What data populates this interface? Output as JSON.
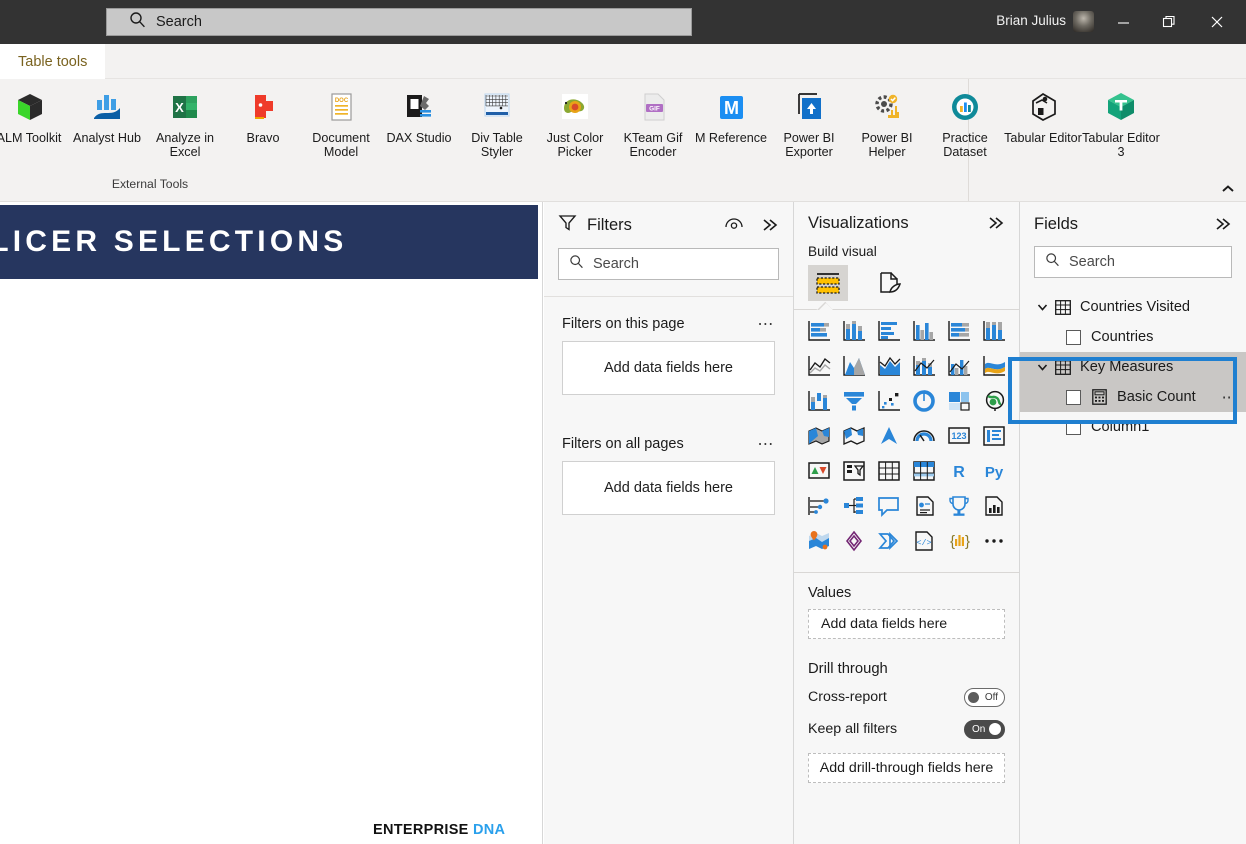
{
  "titlebar": {
    "search_placeholder": "Search",
    "search_icon": "search-icon",
    "user_name": "Brian Julius",
    "minimize_label": "─",
    "maximize_label": "❐",
    "close_label": "✕"
  },
  "ribbon": {
    "context_tab": "Table tools",
    "group_label": "External Tools",
    "collapse_label": "⌃",
    "tools": [
      {
        "name": "ALM Toolkit",
        "icon": "alm-toolkit-icon"
      },
      {
        "name": "Analyst Hub",
        "icon": "analyst-hub-icon"
      },
      {
        "name": "Analyze in Excel",
        "icon": "excel-icon"
      },
      {
        "name": "Bravo",
        "icon": "bravo-icon"
      },
      {
        "name": "Document Model",
        "icon": "document-model-icon"
      },
      {
        "name": "DAX Studio",
        "icon": "dax-studio-icon"
      },
      {
        "name": "Div Table Styler",
        "icon": "div-table-styler-icon"
      },
      {
        "name": "Just Color Picker",
        "icon": "just-color-picker-icon"
      },
      {
        "name": "KTeam Gif Encoder",
        "icon": "kteam-gif-encoder-icon"
      },
      {
        "name": "M Reference",
        "icon": "m-reference-icon"
      },
      {
        "name": "Power BI Exporter",
        "icon": "power-bi-exporter-icon"
      },
      {
        "name": "Power BI Helper",
        "icon": "power-bi-helper-icon"
      },
      {
        "name": "Practice Dataset",
        "icon": "practice-dataset-icon"
      },
      {
        "name": "Tabular Editor",
        "icon": "tabular-editor-icon"
      },
      {
        "name": "Tabular Editor 3",
        "icon": "tabular-editor-3-icon"
      }
    ]
  },
  "canvas": {
    "banner_text": "SLICER SELECTIONS",
    "banner_color": "#26365f",
    "footer_brand_primary": "ENTERPRISE",
    "footer_brand_secondary": "DNA"
  },
  "filters": {
    "title": "Filters",
    "eye_icon": "eye-icon",
    "collapse_icon": "chevron-double-right-icon",
    "funnel_icon": "funnel-icon",
    "search_placeholder": "Search",
    "sections": [
      {
        "label": "Filters on this page",
        "dropzone": "Add data fields here",
        "more": "⋯"
      },
      {
        "label": "Filters on all pages",
        "dropzone": "Add data fields here",
        "more": "⋯"
      }
    ]
  },
  "visualizations": {
    "title": "Visualizations",
    "collapse_icon": "chevron-double-right-icon",
    "build_visual_label": "Build visual",
    "build_tabs": [
      {
        "icon": "fields-build-icon",
        "selected": true
      },
      {
        "icon": "format-paintbrush-icon",
        "selected": false
      }
    ],
    "viz_icons": [
      "stacked-bar-chart-icon",
      "stacked-column-chart-icon",
      "clustered-bar-chart-icon",
      "clustered-column-chart-icon",
      "hundred-percent-stacked-bar-icon",
      "hundred-percent-stacked-column-icon",
      "line-chart-icon",
      "area-chart-icon",
      "stacked-area-chart-icon",
      "line-stacked-column-icon",
      "line-clustered-column-icon",
      "ribbon-chart-icon",
      "waterfall-chart-icon",
      "funnel-chart-icon",
      "scatter-chart-icon",
      "pie-chart-icon",
      "treemap-icon",
      "map-icon",
      "filled-map-icon",
      "shape-map-icon",
      "azure-map-icon",
      "gauge-chart-icon",
      "card-icon",
      "multi-row-card-icon",
      "kpi-icon",
      "slicer-icon",
      "table-icon",
      "matrix-icon",
      "r-script-visual-icon",
      "python-visual-icon",
      "key-influencers-icon",
      "decomposition-tree-icon",
      "qna-icon",
      "smart-narrative-icon",
      "metrics-icon",
      "paginated-report-icon",
      "arcgis-maps-icon",
      "power-apps-icon",
      "power-automate-icon",
      "html-viewer-icon",
      "chiclet-slicer-icon",
      "more-visuals-icon"
    ],
    "values_label": "Values",
    "values_dropzone": "Add data fields here",
    "drill_through_label": "Drill through",
    "cross_report_label": "Cross-report",
    "cross_report_state": "Off",
    "keep_all_filters_label": "Keep all filters",
    "keep_all_filters_state": "On",
    "drill_dropzone": "Add drill-through fields here"
  },
  "fields": {
    "title": "Fields",
    "collapse_icon": "chevron-double-right-icon",
    "search_placeholder": "Search",
    "items": [
      {
        "label": "Countries Visited",
        "type": "table",
        "icon": "table-icon",
        "chevron": "chevron-down-icon"
      },
      {
        "label": "Countries",
        "type": "column",
        "icon": "checkbox-icon"
      },
      {
        "label": "Key Measures",
        "type": "table",
        "icon": "table-icon",
        "chevron": "chevron-down-icon",
        "highlighted": true
      },
      {
        "label": "Basic Count",
        "type": "measure",
        "icon": "calculator-icon",
        "highlighted": true,
        "more": "⋯"
      },
      {
        "label": "Column1",
        "type": "column",
        "icon": "checkbox-icon"
      }
    ],
    "annotation_color": "#1f7fd0"
  }
}
